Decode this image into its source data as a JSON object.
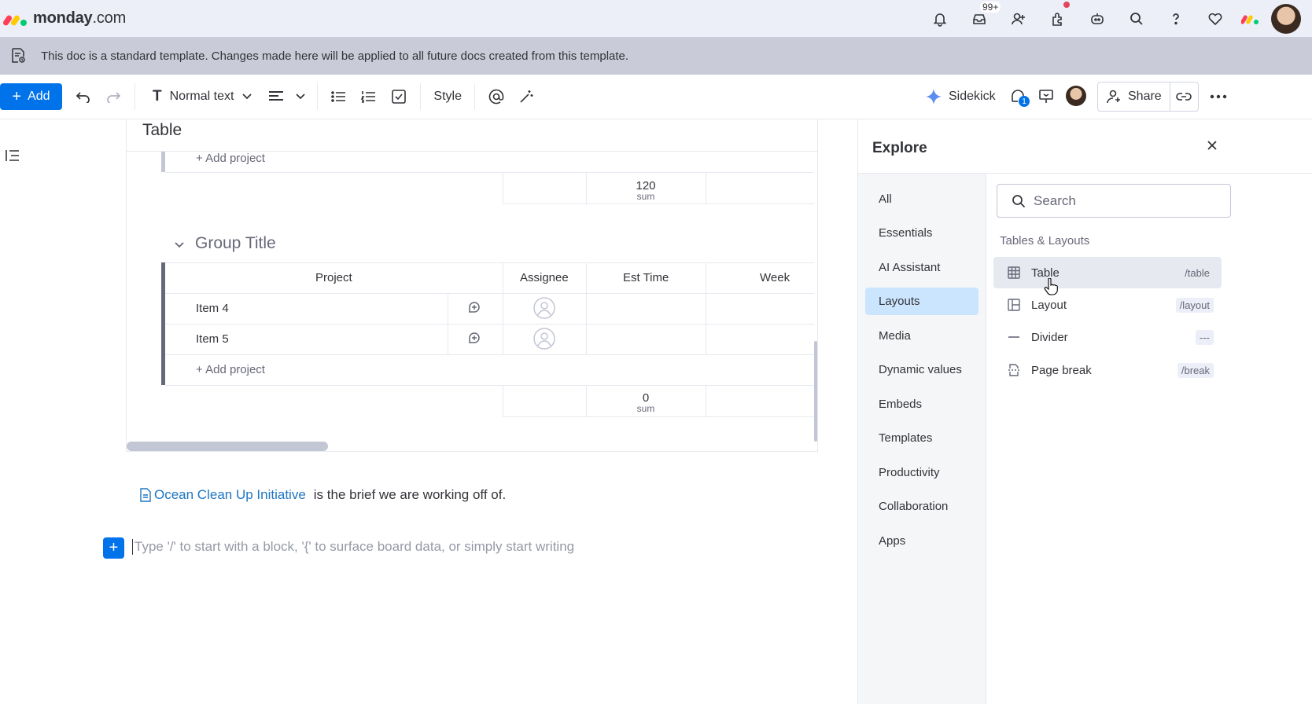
{
  "app": {
    "brand_bold": "monday",
    "brand_light": ".com",
    "logo_colors": [
      "#ff3d57",
      "#ffcb00",
      "#00ca72"
    ],
    "notifications_badge": "99+"
  },
  "banner": {
    "text": "This doc is a standard template. Changes made here will be applied to all future docs created from this template."
  },
  "toolbar": {
    "add_label": "Add",
    "text_style": "Normal text",
    "style_label": "Style",
    "sidekick_label": "Sidekick",
    "updates_badge": "1",
    "share_label": "Share"
  },
  "doc": {
    "table_title": "Table",
    "add_project_label": "+ Add project",
    "group1_sum_value": "120",
    "sum_label": "sum",
    "group_title": "Group Title",
    "columns": [
      "Project",
      "Assignee",
      "Est Time",
      "Week"
    ],
    "rows": [
      {
        "name": "Item 4"
      },
      {
        "name": "Item 5"
      }
    ],
    "group2_sum_value": "0",
    "brief_link": "Ocean Clean Up Initiative",
    "brief_text": "is the brief we are working off of.",
    "placeholder": "Type '/' to start with a block, '{' to surface board data, or simply start writing"
  },
  "explore": {
    "title": "Explore",
    "categories": [
      "All",
      "Essentials",
      "AI Assistant",
      "Layouts",
      "Media",
      "Dynamic values",
      "Embeds",
      "Templates",
      "Productivity",
      "Collaboration",
      "Apps"
    ],
    "active_category": "Layouts",
    "search_placeholder": "Search",
    "section": "Tables & Layouts",
    "items": [
      {
        "label": "Table",
        "shortcut": "/table",
        "icon": "table-icon"
      },
      {
        "label": "Layout",
        "shortcut": "/layout",
        "icon": "layout-icon"
      },
      {
        "label": "Divider",
        "shortcut": "---",
        "icon": "divider-icon"
      },
      {
        "label": "Page break",
        "shortcut": "/break",
        "icon": "page-break-icon"
      }
    ]
  },
  "colors": {
    "primary": "#0073ea",
    "active_category_bg": "#cce5ff",
    "link": "#1f76c2"
  }
}
